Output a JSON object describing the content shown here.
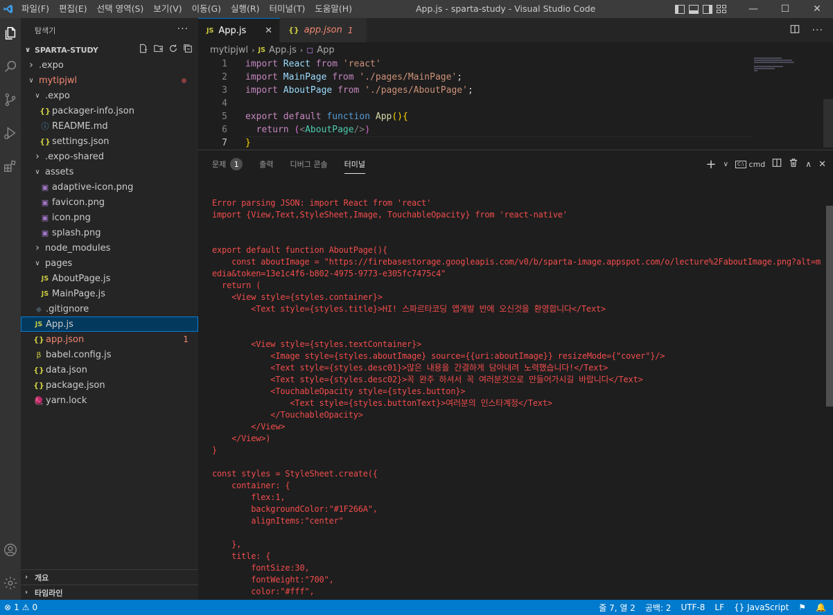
{
  "titlebar": {
    "menu": [
      "파일(F)",
      "편집(E)",
      "선택 영역(S)",
      "보기(V)",
      "이동(G)",
      "실행(R)",
      "터미널(T)",
      "도움말(H)"
    ],
    "title": "App.js - sparta-study - Visual Studio Code"
  },
  "activity_bar": {
    "icons": [
      "explorer-icon",
      "search-icon",
      "source-control-icon",
      "run-debug-icon",
      "extensions-icon",
      "account-icon",
      "manage-gear-icon"
    ]
  },
  "sidebar": {
    "title": "탐색기",
    "more": "···",
    "section": "SPARTA-STUDY",
    "tree": [
      {
        "label": ".expo",
        "indent": 0,
        "type": "folder",
        "open": false
      },
      {
        "label": "mytipjwl",
        "indent": 0,
        "type": "folder",
        "open": true,
        "error": true,
        "dot": true
      },
      {
        "label": ".expo",
        "indent": 1,
        "type": "folder",
        "open": true
      },
      {
        "label": "packager-info.json",
        "indent": 2,
        "type": "json"
      },
      {
        "label": "README.md",
        "indent": 2,
        "type": "info"
      },
      {
        "label": "settings.json",
        "indent": 2,
        "type": "json"
      },
      {
        "label": ".expo-shared",
        "indent": 1,
        "type": "folder",
        "open": false
      },
      {
        "label": "assets",
        "indent": 1,
        "type": "folder",
        "open": true
      },
      {
        "label": "adaptive-icon.png",
        "indent": 2,
        "type": "img"
      },
      {
        "label": "favicon.png",
        "indent": 2,
        "type": "img"
      },
      {
        "label": "icon.png",
        "indent": 2,
        "type": "img"
      },
      {
        "label": "splash.png",
        "indent": 2,
        "type": "img"
      },
      {
        "label": "node_modules",
        "indent": 1,
        "type": "folder",
        "open": false
      },
      {
        "label": "pages",
        "indent": 1,
        "type": "folder",
        "open": true
      },
      {
        "label": "AboutPage.js",
        "indent": 2,
        "type": "js"
      },
      {
        "label": "MainPage.js",
        "indent": 2,
        "type": "js"
      },
      {
        "label": ".gitignore",
        "indent": 1,
        "type": "git"
      },
      {
        "label": "App.js",
        "indent": 1,
        "type": "js",
        "selected": true
      },
      {
        "label": "app.json",
        "indent": 1,
        "type": "json",
        "error": true,
        "badge": "1"
      },
      {
        "label": "babel.config.js",
        "indent": 1,
        "type": "babel"
      },
      {
        "label": "data.json",
        "indent": 1,
        "type": "json"
      },
      {
        "label": "package.json",
        "indent": 1,
        "type": "json"
      },
      {
        "label": "yarn.lock",
        "indent": 1,
        "type": "yarn"
      }
    ],
    "bottom_sections": [
      "개요",
      "타임라인"
    ]
  },
  "editor": {
    "tabs": [
      {
        "label": "App.js",
        "active": true,
        "close": "✕"
      },
      {
        "label": "app.json",
        "active": false,
        "count": "1"
      }
    ],
    "breadcrumb": [
      "mytipjwl",
      "App.js",
      "App"
    ],
    "line_numbers": [
      "1",
      "2",
      "3",
      "4",
      "5",
      "6",
      "7"
    ]
  },
  "panel": {
    "tabs": [
      {
        "label": "문제",
        "count": "1"
      },
      {
        "label": "출력"
      },
      {
        "label": "디버그 콘솔"
      },
      {
        "label": "터미널",
        "active": true
      }
    ],
    "terminal_shell": "cmd",
    "terminal_lines": [
      "Error parsing JSON: import React from 'react'",
      "import {View,Text,StyleSheet,Image, TouchableOpacity} from 'react-native'",
      "",
      "",
      "export default function AboutPage(){",
      "    const aboutImage = \"https://firebasestorage.googleapis.com/v0/b/sparta-image.appspot.com/o/lecture%2FaboutImage.png?alt=m",
      "edia&token=13e1c4f6-b802-4975-9773-e305fc7475c4\"",
      "  return (",
      "    <View style={styles.container}>",
      "        <Text style={styles.title}>HI! 스파르타코딩 앱개발 반에 오신것을 환영합니다</Text>",
      "",
      "",
      "        <View style={styles.textContainer}>",
      "            <Image style={styles.aboutImage} source={{uri:aboutImage}} resizeMode={\"cover\"}/>",
      "            <Text style={styles.desc01}>많은 내용을 간결하게 담아내려 노력했습니다!</Text>",
      "            <Text style={styles.desc02}>꼭 완주 하셔서 꼭 여러분것으로 만들어가시길 바랍니다</Text>",
      "            <TouchableOpacity style={styles.button}>",
      "                <Text style={styles.buttonText}>여러분의 인스타계정</Text>",
      "            </TouchableOpacity>",
      "        </View>",
      "    </View>)",
      "}",
      "",
      "const styles = StyleSheet.create({",
      "    container: {",
      "        flex:1,",
      "        backgroundColor:\"#1F266A\",",
      "        alignItems:\"center\"",
      "",
      "    },",
      "    title: {",
      "        fontSize:30,",
      "        fontWeight:\"700\",",
      "        color:\"#fff\","
    ]
  },
  "statusbar": {
    "errors": "1",
    "warnings": "0",
    "position": "줄 7, 열 2",
    "spaces": "공백: 2",
    "encoding": "UTF-8",
    "eol": "LF",
    "language": "JavaScript"
  },
  "colors": {
    "accent": "#007acc",
    "error": "#f48771",
    "terminal_error": "#f14c4c"
  }
}
